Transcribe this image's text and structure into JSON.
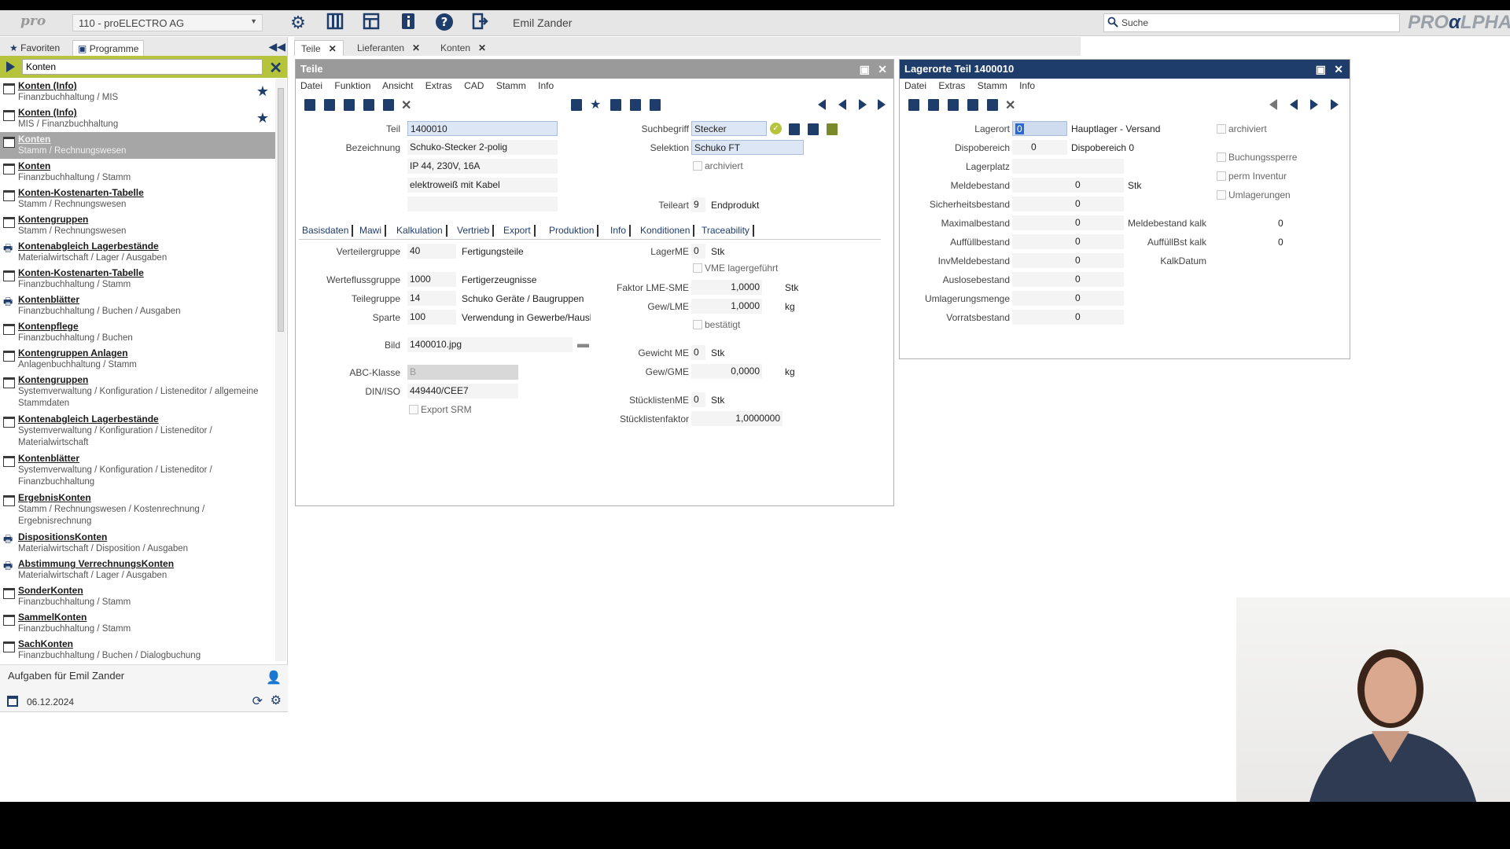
{
  "topbar": {
    "logo": "pro",
    "company": "110 - proELECTRO AG",
    "user": "Emil Zander",
    "search_placeholder": "Suche",
    "brand_left": "PRO",
    "brand_right": "LPHA",
    "brand_alpha": "α"
  },
  "left_tabs": {
    "favorites": "Favoriten",
    "programs": "Programme"
  },
  "program_search": {
    "value": "Konten"
  },
  "programs": [
    {
      "title": "Konten (Info)",
      "sub": "Finanzbuchhaltung / MIS",
      "star": true
    },
    {
      "title": "Konten (Info)",
      "sub": "MIS / Finanzbuchhaltung",
      "star": true
    },
    {
      "title": "Konten",
      "sub": "Stamm / Rechnungswesen",
      "selected": true
    },
    {
      "title": "Konten",
      "sub": "Finanzbuchhaltung / Stamm"
    },
    {
      "title": "Konten-Kostenarten-Tabelle",
      "sub": "Stamm / Rechnungswesen"
    },
    {
      "title": "Kontengruppen",
      "sub": "Stamm / Rechnungswesen"
    },
    {
      "title": "Kontenabgleich Lagerbestände",
      "sub": "Materialwirtschaft / Lager / Ausgaben"
    },
    {
      "title": "Konten-Kostenarten-Tabelle",
      "sub": "Finanzbuchhaltung / Stamm"
    },
    {
      "title": "Kontenblätter",
      "sub": "Finanzbuchhaltung / Buchen / Ausgaben"
    },
    {
      "title": "Kontenpflege",
      "sub": "Finanzbuchhaltung / Buchen"
    },
    {
      "title": "Kontengruppen Anlagen",
      "sub": "Anlagenbuchhaltung / Stamm"
    },
    {
      "title": "Kontengruppen",
      "sub": "Systemverwaltung / Konfiguration / Listeneditor / allgemeine Stammdaten"
    },
    {
      "title": "Kontenabgleich Lagerbestände",
      "sub": "Systemverwaltung / Konfiguration / Listeneditor / Materialwirtschaft"
    },
    {
      "title": "Kontenblätter",
      "sub": "Systemverwaltung / Konfiguration / Listeneditor / Finanzbuchhaltung"
    },
    {
      "title": "ErgebnisKonten",
      "sub": "Stamm / Rechnungswesen / Kostenrechnung / Ergebnisrechnung"
    },
    {
      "title": "DispositionsKonten",
      "sub": "Materialwirtschaft / Disposition / Ausgaben"
    },
    {
      "title": "Abstimmung VerrechnungsKonten",
      "sub": "Materialwirtschaft / Lager / Ausgaben"
    },
    {
      "title": "SonderKonten",
      "sub": "Finanzbuchhaltung / Stamm"
    },
    {
      "title": "SammelKonten",
      "sub": "Finanzbuchhaltung / Stamm"
    },
    {
      "title": "SachKonten",
      "sub": "Finanzbuchhaltung / Buchen / Dialogbuchung"
    }
  ],
  "tasks": {
    "title": "Aufgaben für Emil Zander",
    "date": "06.12.2024"
  },
  "doc_tabs": [
    "Teile",
    "Lieferanten",
    "Konten"
  ],
  "teile": {
    "title": "Teile",
    "menu": [
      "Datei",
      "Funktion",
      "Ansicht",
      "Extras",
      "CAD",
      "Stamm",
      "Info"
    ],
    "labels": {
      "teil": "Teil",
      "bezeichnung": "Bezeichnung",
      "suchbegriff": "Suchbegriff",
      "selektion": "Selektion",
      "archiviert": "archiviert",
      "teileart": "Teileart"
    },
    "values": {
      "teil": "1400010",
      "bez1": "Schuko-Stecker 2-polig",
      "bez2": "IP 44, 230V, 16A",
      "bez3": "elektroweiß mit Kabel",
      "suchbegriff": "Stecker",
      "selektion": "Schuko FT",
      "teileart_code": "9",
      "teileart_text": "Endprodukt"
    },
    "subtabs": [
      "Basisdaten",
      "Mawi",
      "Kalkulation",
      "Vertrieb",
      "Export",
      "Produktion",
      "Info",
      "Konditionen",
      "Traceability"
    ],
    "basis": {
      "verteilergruppe_l": "Verteilergruppe",
      "verteilergruppe": "40",
      "verteilergruppe_t": "Fertigungsteile",
      "wertefluss_l": "Werteflussgruppe",
      "wertefluss": "1000",
      "wertefluss_t": "Fertigerzeugnisse",
      "teilegruppe_l": "Teilegruppe",
      "teilegruppe": "14",
      "teilegruppe_t": "Schuko Geräte / Baugruppen",
      "sparte_l": "Sparte",
      "sparte": "100",
      "sparte_t": "Verwendung in Gewerbe/Hausl",
      "bild_l": "Bild",
      "bild": "1400010.jpg",
      "abc_l": "ABC-Klasse",
      "abc": "B",
      "din_l": "DIN/ISO",
      "din": "449440/CEE7",
      "export_srm": "Export SRM",
      "lagerme_l": "LagerME",
      "lagerme": "0",
      "lagerme_u": "Stk",
      "vme": "VME lagergeführt",
      "faktor_l": "Faktor LME-SME",
      "faktor": "1,0000",
      "faktor_u": "Stk",
      "gewlme_l": "Gew/LME",
      "gewlme": "1,0000",
      "gewlme_u": "kg",
      "bestaetigt": "bestätigt",
      "gewichtme_l": "Gewicht ME",
      "gewichtme": "0",
      "gewichtme_u": "Stk",
      "gewgme_l": "Gew/GME",
      "gewgme": "0,0000",
      "gewgme_u": "kg",
      "stlme_l": "StücklistenME",
      "stlme": "0",
      "stlme_u": "Stk",
      "stlf_l": "Stücklistenfaktor",
      "stlf": "1,0000000"
    }
  },
  "lager": {
    "title": "Lagerorte Teil 1400010",
    "menu": [
      "Datei",
      "Extras",
      "Stamm",
      "Info"
    ],
    "lagerort_l": "Lagerort",
    "lagerort": "0",
    "lagerort_t": "Hauptlager - Versand",
    "dispo_l": "Dispobereich",
    "dispo": "0",
    "dispo_t": "Dispobereich 0",
    "lagerplatz_l": "Lagerplatz",
    "rows": [
      {
        "label": "Meldebestand",
        "value": "0",
        "unit": "Stk"
      },
      {
        "label": "Sicherheitsbestand",
        "value": "0"
      },
      {
        "label": "Maximalbestand",
        "value": "0"
      },
      {
        "label": "Auffüllbestand",
        "value": "0"
      },
      {
        "label": "InvMeldebestand",
        "value": "0"
      },
      {
        "label": "Auslosebestand",
        "value": "0"
      },
      {
        "label": "Umlagerungsmenge",
        "value": "0"
      },
      {
        "label": "Vorratsbestand",
        "value": "0"
      }
    ],
    "checks": [
      "archiviert",
      "Buchungssperre",
      "perm Inventur",
      "Umlagerungen"
    ],
    "kalk": [
      {
        "label": "Meldebestand kalk",
        "value": "0"
      },
      {
        "label": "AuffüllBst kalk",
        "value": "0"
      },
      {
        "label": "KalkDatum",
        "value": ""
      }
    ]
  }
}
